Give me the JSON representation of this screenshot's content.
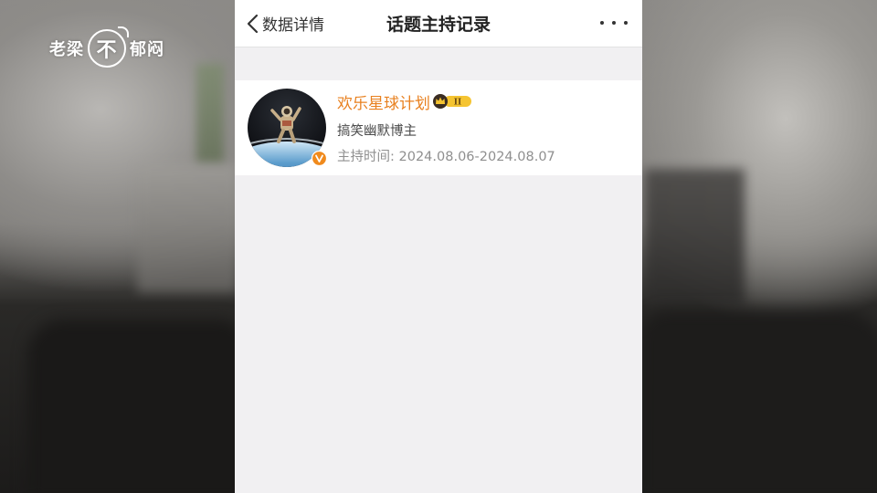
{
  "watermark": {
    "left_text": "老梁",
    "circle_text": "不",
    "right_text": "郁闷"
  },
  "nav": {
    "back_label": "数据详情",
    "title": "话题主持记录",
    "more_icon": "more-horizontal-icon"
  },
  "records": [
    {
      "name": "欢乐星球计划",
      "description": "搞笑幽默博主",
      "host_time_label": "主持时间:",
      "host_time_value": "2024.08.06-2024.08.07",
      "badge_text": "II",
      "verified_icon": "verified-v-icon",
      "avatar_icon": "astronaut-avatar"
    }
  ],
  "colors": {
    "name": "#e8801f",
    "verified": "#f08a1c",
    "badge": "#f5c431",
    "page_bg": "#f1f0f2"
  }
}
